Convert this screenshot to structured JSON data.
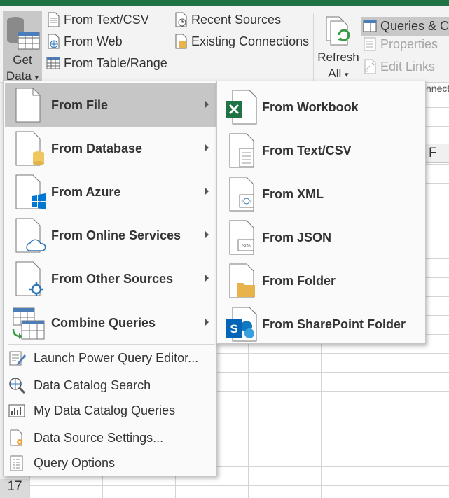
{
  "ribbon": {
    "get_data": {
      "label_line1": "Get",
      "label_line2": "Data",
      "dropdown_glyph": "▾"
    },
    "from_text_csv": "From Text/CSV",
    "from_web": "From Web",
    "from_table_range": "From Table/Range",
    "recent_sources": "Recent Sources",
    "existing_connections": "Existing Connections",
    "refresh_all": {
      "label_line1": "Refresh",
      "label_line2": "All",
      "dropdown_glyph": "▾"
    },
    "queries_connections": "Queries & C",
    "properties": "Properties",
    "edit_links": "Edit Links",
    "group_label_cut": "nnect"
  },
  "sheet": {
    "column_f": "F",
    "row_17": "17"
  },
  "get_data_menu": {
    "items": [
      {
        "label": "From File",
        "has_submenu": true,
        "highlighted": true,
        "icon": "file-icon"
      },
      {
        "label": "From Database",
        "has_submenu": true,
        "icon": "database-icon"
      },
      {
        "label": "From Azure",
        "has_submenu": true,
        "icon": "azure-windows-icon"
      },
      {
        "label": "From Online Services",
        "has_submenu": true,
        "icon": "cloud-icon"
      },
      {
        "label": "From Other Sources",
        "has_submenu": true,
        "icon": "other-sources-icon"
      },
      {
        "label": "Combine Queries",
        "has_submenu": true,
        "icon": "combine-queries-icon"
      }
    ],
    "commands": [
      {
        "label": "Launch Power Query Editor...",
        "icon": "power-query-editor-icon"
      },
      {
        "label": "Data Catalog Search",
        "icon": "catalog-search-icon"
      },
      {
        "label": "My Data Catalog Queries",
        "icon": "catalog-queries-icon"
      },
      {
        "label": "Data Source Settings...",
        "icon": "data-source-settings-icon"
      },
      {
        "label": "Query Options",
        "icon": "query-options-icon"
      }
    ]
  },
  "from_file_submenu": {
    "items": [
      {
        "label": "From Workbook",
        "icon": "excel-workbook-icon"
      },
      {
        "label": "From Text/CSV",
        "icon": "text-csv-icon"
      },
      {
        "label": "From XML",
        "icon": "xml-icon"
      },
      {
        "label": "From JSON",
        "icon": "json-icon"
      },
      {
        "label": "From Folder",
        "icon": "folder-icon"
      },
      {
        "label": "From SharePoint Folder",
        "icon": "sharepoint-icon"
      }
    ]
  },
  "colors": {
    "excel_green": "#217346",
    "menu_highlight": "#c6c6c6",
    "ribbon_bg": "#f3f3f3",
    "azure_blue": "#0078d4",
    "folder_yellow": "#e8b34a",
    "sharepoint_blue": "#0f78bf",
    "db_yellow": "#f0c75e"
  }
}
